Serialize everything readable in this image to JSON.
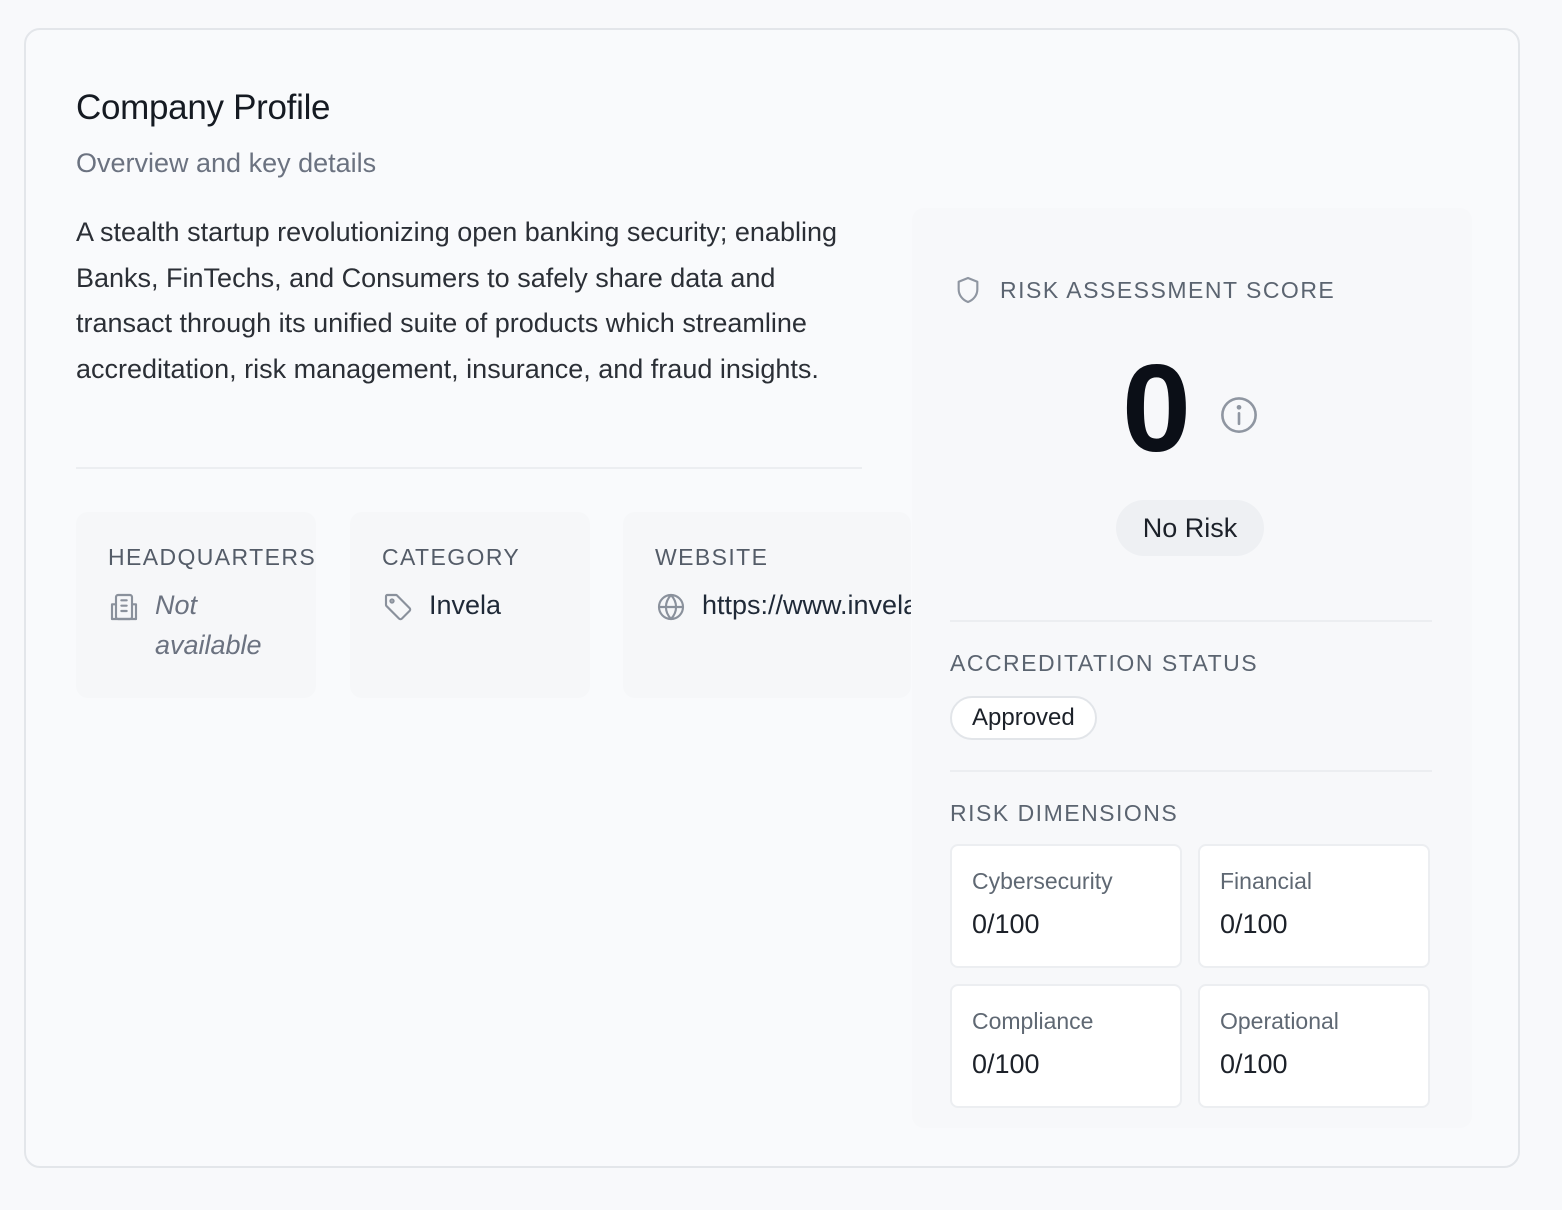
{
  "profile": {
    "title": "Company Profile",
    "subtitle": "Overview and key details",
    "description": "A stealth startup revolutionizing open banking security; enabling Banks, FinTechs, and Consumers to safely share data and transact through its unified suite of products which streamline accreditation, risk management, insurance, and fraud insights."
  },
  "details": {
    "headquarters": {
      "label": "HEADQUARTERS",
      "value": "Not available",
      "icon": "building-icon"
    },
    "category": {
      "label": "CATEGORY",
      "value": "Invela",
      "icon": "tag-icon"
    },
    "website": {
      "label": "WEBSITE",
      "value": "https://www.invela.com",
      "icon": "globe-icon"
    }
  },
  "risk": {
    "label": "RISK ASSESSMENT SCORE",
    "score": "0",
    "level": "No Risk",
    "icon": "shield-icon"
  },
  "accreditation": {
    "label": "ACCREDITATION STATUS",
    "status": "Approved"
  },
  "dimensions": {
    "label": "RISK DIMENSIONS",
    "items": [
      {
        "name": "Cybersecurity",
        "score": "0/100"
      },
      {
        "name": "Financial",
        "score": "0/100"
      },
      {
        "name": "Compliance",
        "score": "0/100"
      },
      {
        "name": "Operational",
        "score": "0/100"
      }
    ]
  },
  "colors": {
    "background": "#f8f9fb",
    "card_border": "#e3e6ea",
    "text_primary": "#1f2937",
    "text_muted": "#6b7280",
    "icon_gray": "#8f96a1"
  }
}
